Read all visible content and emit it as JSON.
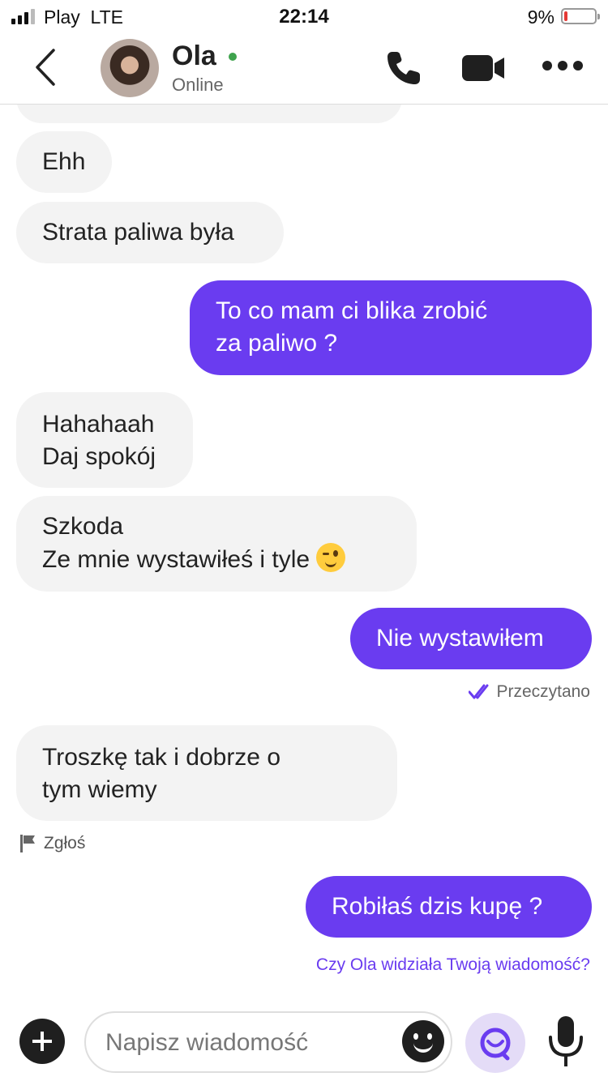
{
  "status_bar": {
    "carrier": "Play",
    "network": "LTE",
    "time": "22:14",
    "battery_pct": "9%",
    "battery_level": 0.09
  },
  "header": {
    "contact_name": "Ola",
    "presence": "Online",
    "online_color": "#3fa34d"
  },
  "messages": [
    {
      "dir": "in",
      "lines": [
        "Ehh"
      ]
    },
    {
      "dir": "in",
      "lines": [
        "Strata paliwa była"
      ]
    },
    {
      "dir": "out",
      "lines": [
        "To co mam ci blika zrobić",
        "za paliwo ?"
      ]
    },
    {
      "dir": "in",
      "lines": [
        "Hahahaah",
        "Daj spokój"
      ]
    },
    {
      "dir": "in",
      "lines": [
        "Szkoda",
        "Ze mnie wystawiłeś i tyle"
      ]
    },
    {
      "dir": "out",
      "lines": [
        "Nie wystawiłem"
      ]
    },
    {
      "dir": "in",
      "lines": [
        "Troszkę tak i dobrze o",
        "tym wiemy"
      ]
    },
    {
      "dir": "out",
      "lines": [
        "Robiłaś dzis kupę ?"
      ]
    }
  ],
  "read_receipt": "Przeczytano",
  "report_label": "Zgłoś",
  "seen_question": "Czy Ola widziała Twoją wiadomość?",
  "composer": {
    "placeholder": "Napisz wiadomość"
  },
  "colors": {
    "accent": "#6a3cf0",
    "incoming_bubble": "#f3f3f3"
  },
  "icons": [
    "back-icon",
    "phone-icon",
    "video-icon",
    "more-icon",
    "double-check-icon",
    "flag-icon",
    "plus-icon",
    "emoji-icon",
    "ai-assistant-icon",
    "mic-icon",
    "wink-emoji-icon"
  ]
}
